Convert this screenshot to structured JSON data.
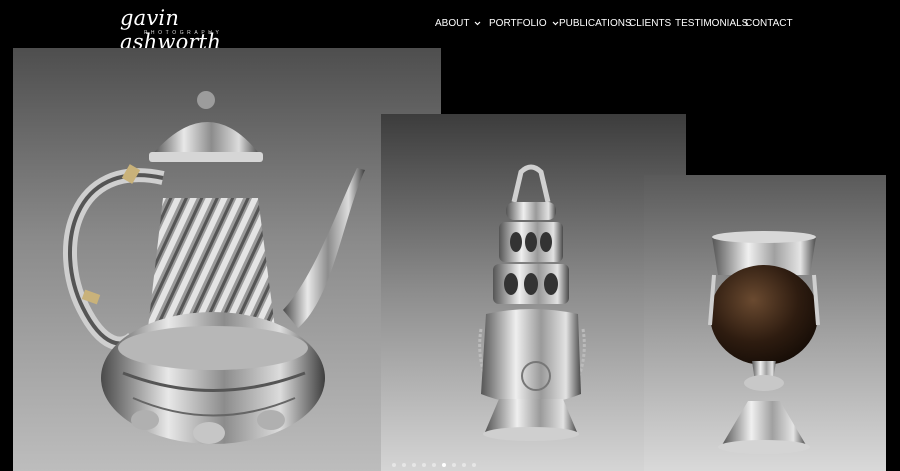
{
  "brand": {
    "name": "gavin ashworth",
    "tagline": "PHOTOGRAPHY"
  },
  "nav": {
    "items": [
      {
        "label": "ABOUT",
        "has_dropdown": true
      },
      {
        "label": "PORTFOLIO",
        "has_dropdown": true
      },
      {
        "label": "PUBLICATIONS",
        "has_dropdown": false
      },
      {
        "label": "CLIENTS",
        "has_dropdown": false
      },
      {
        "label": "TESTIMONIALS",
        "has_dropdown": false
      },
      {
        "label": "CONTACT",
        "has_dropdown": false
      }
    ]
  },
  "gallery": {
    "images": [
      {
        "subject": "silver-coffee-pot"
      },
      {
        "subject": "silver-caster"
      },
      {
        "subject": "silver-mounted-coconut-cup"
      }
    ],
    "slider": {
      "total_dots": 9,
      "active_index": 5
    }
  }
}
